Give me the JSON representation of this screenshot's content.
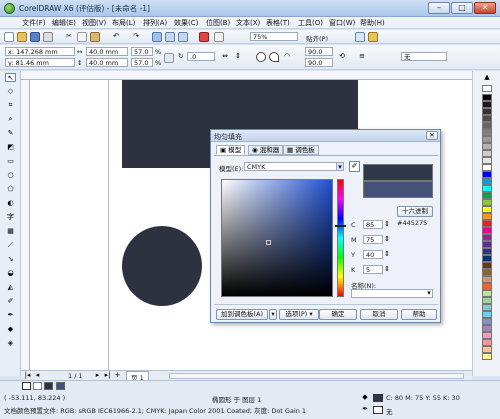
{
  "window": {
    "title": "CorelDRAW X6 (评估版) - [未命名 -1]",
    "min_label": "–",
    "max_label": "□",
    "close_label": "✕"
  },
  "menu": {
    "items": [
      "文件(F)",
      "编辑(E)",
      "视图(V)",
      "布局(L)",
      "排列(A)",
      "效果(C)",
      "位图(B)",
      "文本(X)",
      "表格(T)",
      "工具(O)",
      "窗口(W)",
      "帮助(H)"
    ]
  },
  "toolbar": {
    "zoom": "75%",
    "snap_label": "贴齐(P)"
  },
  "propbar": {
    "x": "x: 147.268 mm",
    "y": "y: 81.46 mm",
    "width": "40.0 mm",
    "height": "40.0 mm",
    "scale_w": "57.0",
    "scale_h": "57.0",
    "percent": "%",
    "rotation": ".0",
    "corner1": "90.0",
    "corner2": "90.0",
    "outline": "无"
  },
  "dialog": {
    "title": "均匀填充",
    "tabs": [
      "模型",
      "混和器",
      "调色板"
    ],
    "model_label": "模型(E):",
    "model_value": "CMYK",
    "hex_button": "十六进制",
    "hex_value": "#445275",
    "channels": [
      {
        "label": "C",
        "value": "85"
      },
      {
        "label": "M",
        "value": "75"
      },
      {
        "label": "Y",
        "value": "40"
      },
      {
        "label": "K",
        "value": "5"
      }
    ],
    "name_label": "名称(N):",
    "add_palette_button": "加到调色板(A)",
    "options_button": "选项(P)",
    "ok_button": "确定",
    "cancel_button": "取消",
    "help_button": "帮助"
  },
  "pagenav": {
    "page_count": "1 / 1",
    "page_tab": "页 1"
  },
  "status": {
    "coords": "( -53.111, 83.224 )",
    "object_info": "椭圆形 于 图层 1",
    "color_profile": "文档颜色预置文件: RGB: sRGB IEC61966-2.1; CMYK: Japan Color 2001 Coated; 灰度: Dot Gain 15%",
    "fill_info": "C: 80 M: 75 Y: 55 K: 30",
    "outline_info": "无"
  },
  "colors": {
    "shape_fill": "#2e3240",
    "selected_fill": "#445275",
    "current_fill": "#31374a"
  }
}
